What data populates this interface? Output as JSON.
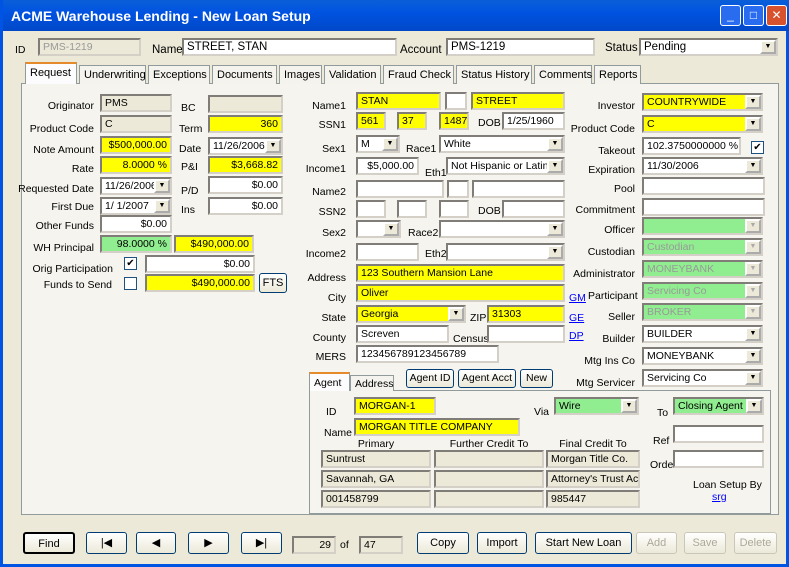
{
  "window": {
    "title": "ACME Warehouse Lending - New Loan Setup"
  },
  "header": {
    "id_label": "ID",
    "id_value": "PMS-1219",
    "name_label": "Name",
    "name_value": "STREET, STAN",
    "account_label": "Account",
    "account_value": "PMS-1219",
    "status_label": "Status",
    "status_value": "Pending"
  },
  "tabs": [
    "Request",
    "Underwriting",
    "Exceptions",
    "Documents",
    "Images",
    "Validation",
    "Fraud Check",
    "Status History",
    "Comments",
    "Reports"
  ],
  "loan": {
    "originator_label": "Originator",
    "originator": "PMS",
    "bc_label": "BC",
    "bc": "",
    "product_code_label": "Product Code",
    "product_code": "C",
    "term_label": "Term",
    "term": "360",
    "note_amount_label": "Note Amount",
    "note_amount": "$500,000.00",
    "date_label": "Date",
    "date": "11/26/2006",
    "rate_label": "Rate",
    "rate": "8.0000 %",
    "pi_label": "P&I",
    "pi": "$3,668.82",
    "requested_date_label": "Requested Date",
    "requested_date": "11/26/2006",
    "pd_label": "P/D",
    "pd": "$0.00",
    "first_due_label": "First Due",
    "first_due": "1/ 1/2007",
    "ins_label": "Ins",
    "ins": "$0.00",
    "other_funds_label": "Other Funds",
    "other_funds": "$0.00",
    "wh_principal_label": "WH Principal",
    "wh_principal_pct": "98.0000 %",
    "wh_principal_amt": "$490,000.00",
    "orig_participation_label": "Orig Participation",
    "orig_participation_checked": true,
    "orig_participation": "$0.00",
    "funds_to_send_label": "Funds to Send",
    "funds_to_send_checked": false,
    "funds_to_send": "$490,000.00",
    "fts_button": "FTS"
  },
  "borrower": {
    "name1_label": "Name1",
    "first1": "STAN",
    "mi1": "",
    "last1": "STREET",
    "ssn1_label": "SSN1",
    "ssn1": [
      "561",
      "37",
      "1487"
    ],
    "dob_label": "DOB",
    "dob1": "1/25/1960",
    "sex1_label": "Sex1",
    "sex1": "M",
    "race1_label": "Race1",
    "race1": "White",
    "income1_label": "Income1",
    "income1": "$5,000.00",
    "eth1_label": "Eth1",
    "eth1": "Not Hispanic or Latino",
    "name2_label": "Name2",
    "ssn2_label": "SSN2",
    "sex2_label": "Sex2",
    "race2_label": "Race2",
    "income2_label": "Income2",
    "eth2_label": "Eth2",
    "address_label": "Address",
    "address": "123 Southern Mansion Lane",
    "city_label": "City",
    "city": "Oliver",
    "state_label": "State",
    "state": "Georgia",
    "zip_label": "ZIP",
    "zip": "31303",
    "county_label": "County",
    "county": "Screven",
    "census_label": "Census",
    "census": "",
    "mers_label": "MERS",
    "mers": "123456789123456789",
    "links": [
      "GM",
      "GE",
      "DP"
    ]
  },
  "parties": {
    "investor_label": "Investor",
    "investor": "COUNTRYWIDE",
    "product_code_label": "Product Code",
    "product_code": "C",
    "takeout_label": "Takeout",
    "takeout": "102.3750000000 %",
    "takeout_checked": true,
    "expiration_label": "Expiration",
    "expiration": "11/30/2006",
    "pool_label": "Pool",
    "commitment_label": "Commitment",
    "officer_label": "Officer",
    "officer": "",
    "custodian_label": "Custodian",
    "custodian": "Custodian",
    "administrator_label": "Administrator",
    "administrator": "MONEYBANK",
    "participant_label": "Participant",
    "participant": "Servicing Co",
    "seller_label": "Seller",
    "seller": "BROKER",
    "builder_label": "Builder",
    "builder": "BUILDER",
    "mtg_ins_label": "Mtg Ins Co",
    "mtg_ins": "MONEYBANK",
    "mtg_servicer_label": "Mtg Servicer",
    "mtg_servicer": "Servicing Co"
  },
  "agent": {
    "tabs": [
      "Agent",
      "Address"
    ],
    "buttons": [
      "Agent ID",
      "Agent Acct",
      "New"
    ],
    "id_label": "ID",
    "id": "MORGAN-1",
    "name_label": "Name",
    "name": "MORGAN TITLE COMPANY",
    "via_label": "Via",
    "via": "Wire",
    "to_label": "To",
    "to": "Closing Agent",
    "columns": [
      "Primary",
      "Further Credit To",
      "Final Credit To"
    ],
    "rows": [
      [
        "Suntrust",
        "",
        "Morgan Title Co."
      ],
      [
        "Savannah, GA",
        "",
        "Attorney's Trust Acco"
      ],
      [
        "001458799",
        "",
        "985447"
      ]
    ],
    "ref_label": "Ref",
    "order_label": "Order",
    "setup_by_label": "Loan Setup By",
    "setup_by": "srg"
  },
  "footer": {
    "find": "Find",
    "record": "29",
    "of": "of",
    "total": "47",
    "copy": "Copy",
    "import": "Import",
    "start_new": "Start New Loan",
    "add": "Add",
    "save": "Save",
    "delete": "Delete"
  },
  "colors": {
    "required": "#ffff00",
    "computed": "#90ee90",
    "titlebar": "#0053e1"
  }
}
